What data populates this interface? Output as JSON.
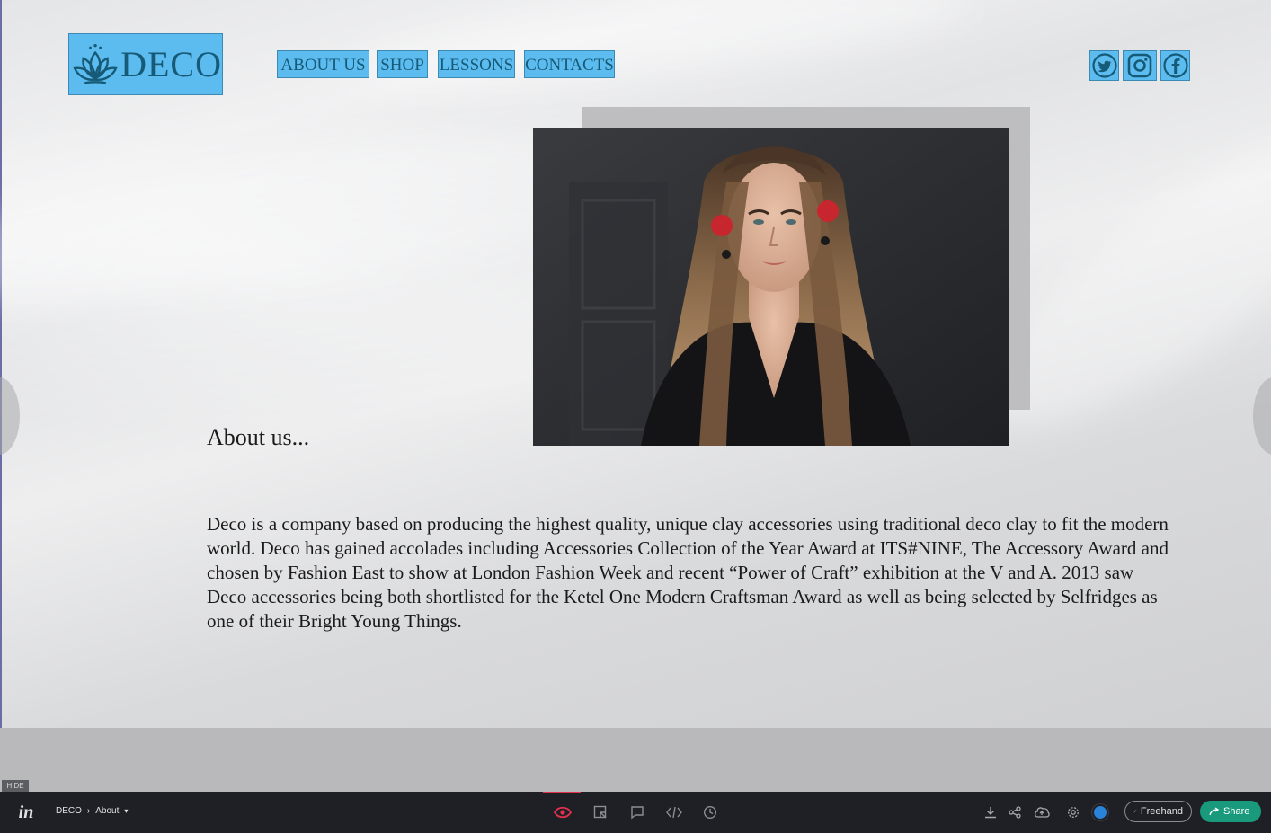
{
  "site": {
    "logo": {
      "text": "DECO",
      "icon": "lotus-icon",
      "color": "#5dbcef"
    },
    "nav": [
      {
        "label": "ABOUT US"
      },
      {
        "label": "SHOP"
      },
      {
        "label": "LESSONS"
      },
      {
        "label": "CONTACTS"
      }
    ],
    "social": [
      {
        "name": "twitter-icon"
      },
      {
        "name": "instagram-icon"
      },
      {
        "name": "facebook-icon"
      }
    ],
    "about": {
      "title": "About us...",
      "body": "Deco is a company based on producing the highest quality, unique clay accessories using traditional deco clay to fit the modern world. Deco has gained accolades including Accessories Collection of the Year Award at ITS#NINE, The Accessory Award and chosen by Fashion East to show at London Fashion Week and recent “Power of Craft” exhibition at the V and A. 2013 saw Deco accessories being both shortlisted for the Ketel One Modern Craftsman Award as well as being selected by Selfridges as one of their Bright Young Things."
    },
    "photo": {
      "subject": "model-portrait"
    }
  },
  "viewer": {
    "hide_label": "HIDE",
    "logo": "in",
    "breadcrumb": {
      "project": "DECO",
      "separator": "›",
      "screen": "About",
      "dropdown": "▾"
    },
    "modes": [
      "preview-icon",
      "inspect-icon",
      "comment-icon",
      "code-icon",
      "history-icon"
    ],
    "actions": [
      "download-icon",
      "share-network-icon",
      "cloud-sync-icon",
      "settings-icon"
    ],
    "freehand_label": "Freehand",
    "share_label": "Share",
    "accent": "#e2304f",
    "share_color": "#1a9a7d"
  }
}
